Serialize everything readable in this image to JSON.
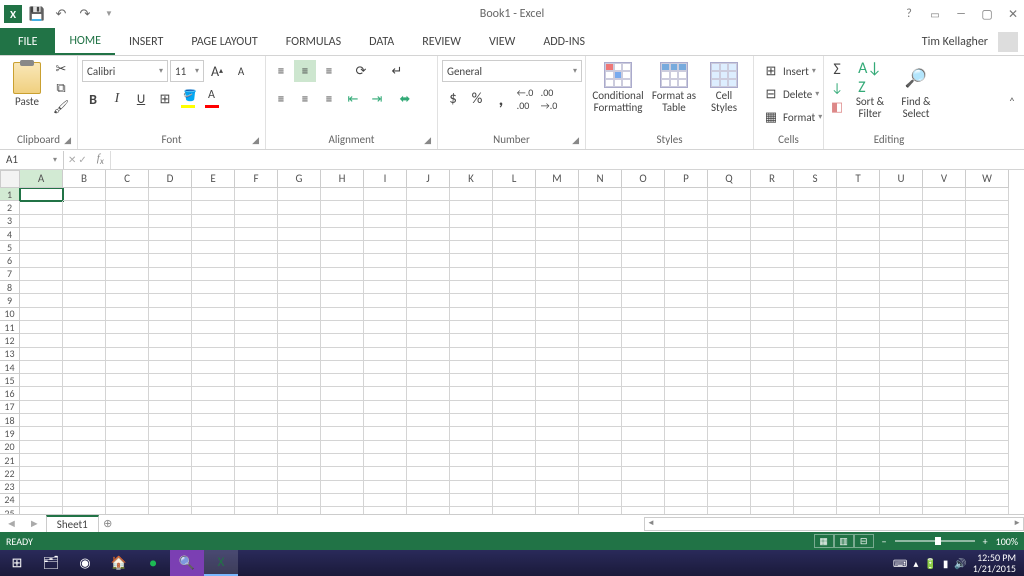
{
  "window": {
    "title": "Book1 - Excel",
    "user": "Tim Kellagher"
  },
  "tabs": {
    "file": "FILE",
    "items": [
      "HOME",
      "INSERT",
      "PAGE LAYOUT",
      "FORMULAS",
      "DATA",
      "REVIEW",
      "VIEW",
      "ADD-INS"
    ],
    "active": 0
  },
  "ribbon": {
    "clipboard": {
      "label": "Clipboard",
      "paste": "Paste"
    },
    "font": {
      "label": "Font",
      "name": "Calibri",
      "size": "11"
    },
    "alignment": {
      "label": "Alignment"
    },
    "number": {
      "label": "Number",
      "format": "General"
    },
    "styles": {
      "label": "Styles",
      "cf": "Conditional Formatting",
      "ft": "Format as Table",
      "cs": "Cell Styles"
    },
    "cells": {
      "label": "Cells",
      "insert": "Insert",
      "delete": "Delete",
      "format": "Format"
    },
    "editing": {
      "label": "Editing",
      "sort": "Sort & Filter",
      "find": "Find & Select"
    }
  },
  "namebox": "A1",
  "columns": [
    "A",
    "B",
    "C",
    "D",
    "E",
    "F",
    "G",
    "H",
    "I",
    "J",
    "K",
    "L",
    "M",
    "N",
    "O",
    "P",
    "Q",
    "R",
    "S",
    "T",
    "U",
    "V",
    "W"
  ],
  "rows": 26,
  "active_cell": {
    "row": 1,
    "col": 0
  },
  "sheet": {
    "name": "Sheet1"
  },
  "status": {
    "ready": "READY",
    "zoom": "100%"
  },
  "tray": {
    "time": "12:50 PM",
    "date": "1/21/2015"
  }
}
